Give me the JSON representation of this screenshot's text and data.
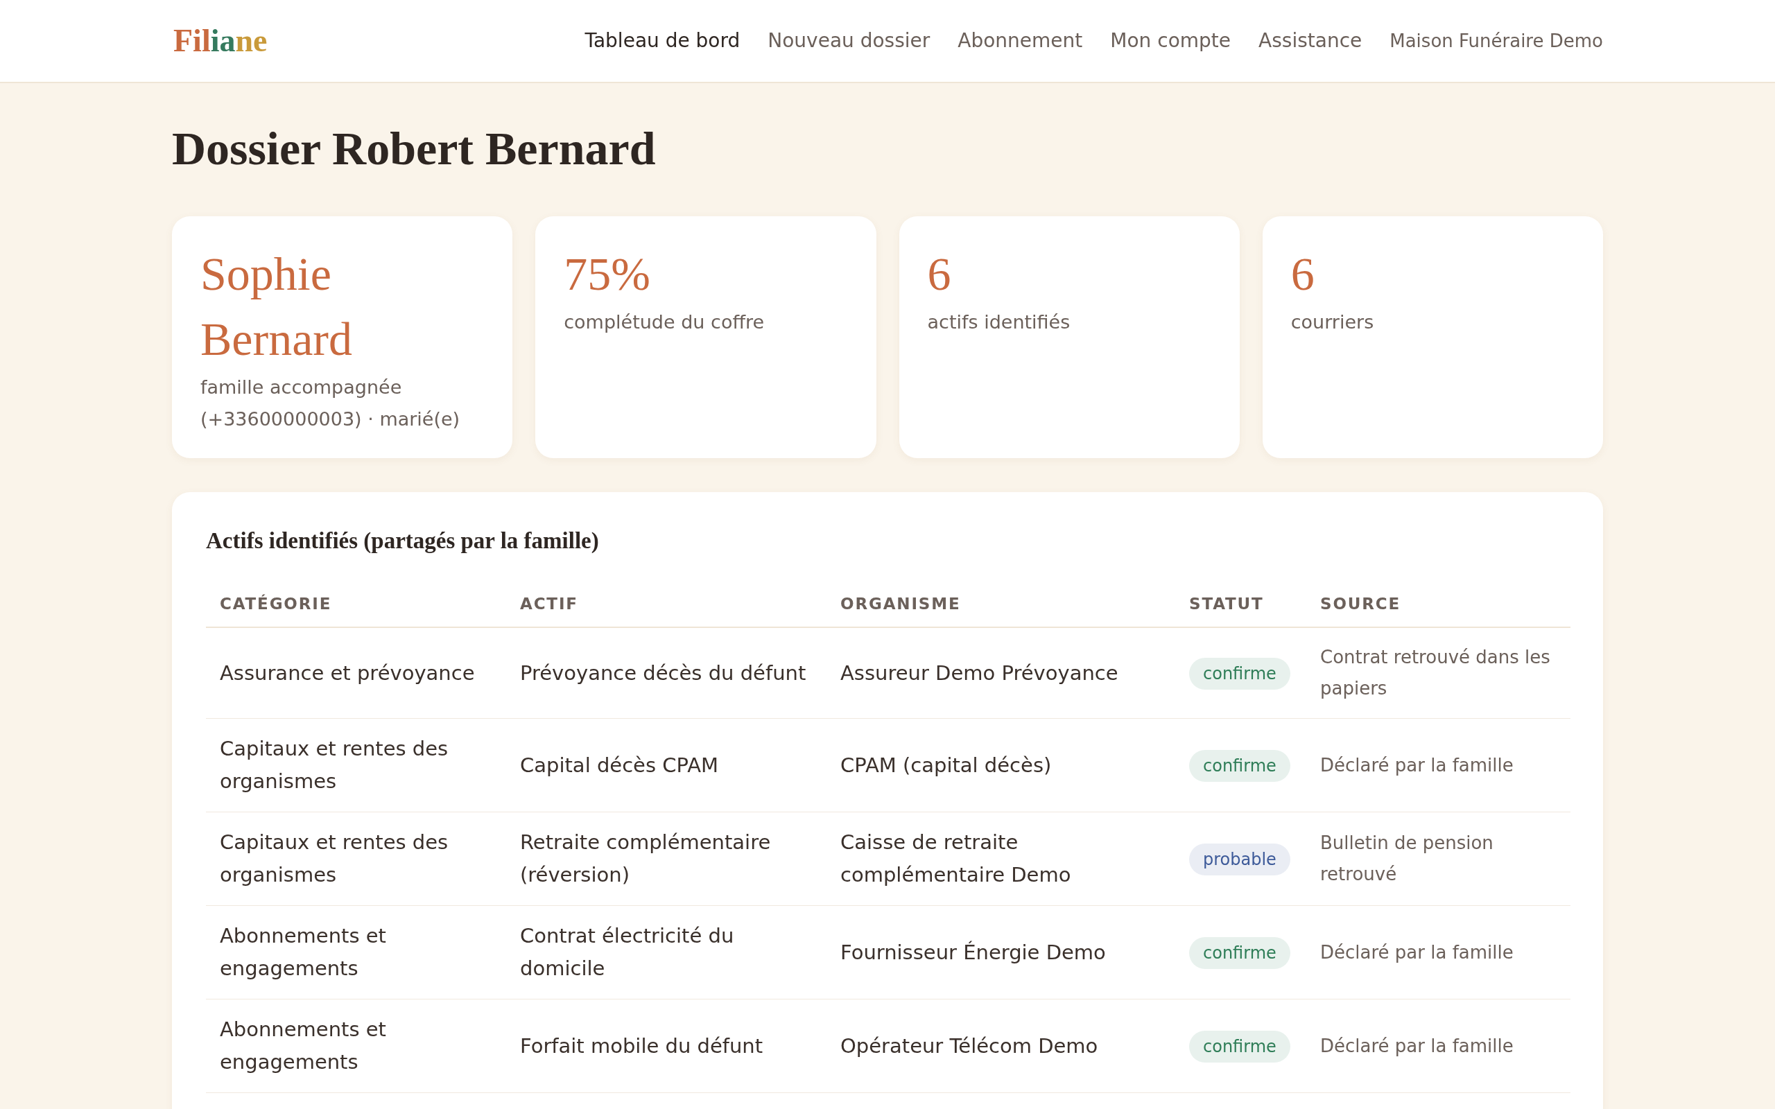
{
  "header": {
    "logo": [
      {
        "text": "Fil",
        "color": "#c96a3f"
      },
      {
        "text": "ia",
        "color": "#357a5e"
      },
      {
        "text": "ne",
        "color": "#c99a3a"
      }
    ],
    "nav": [
      {
        "label": "Tableau de bord",
        "selected": true
      },
      {
        "label": "Nouveau dossier",
        "selected": false
      },
      {
        "label": "Abonnement",
        "selected": false
      },
      {
        "label": "Mon compte",
        "selected": false
      },
      {
        "label": "Assistance",
        "selected": false
      }
    ],
    "account": "Maison Funéraire Demo"
  },
  "page_title": "Dossier Robert Bernard",
  "stats": [
    {
      "value": "Sophie Bernard",
      "label": "famille accompagnée (+33600000003) · marié(e)"
    },
    {
      "value": "75%",
      "label": "complétude du coffre"
    },
    {
      "value": "6",
      "label": "actifs identifiés"
    },
    {
      "value": "6",
      "label": "courriers"
    }
  ],
  "assets": {
    "title": "Actifs identifiés (partagés par la famille)",
    "columns": [
      "CATÉGORIE",
      "ACTIF",
      "ORGANISME",
      "STATUT",
      "SOURCE"
    ],
    "rows": [
      {
        "category": "Assurance et prévoyance",
        "asset": "Prévoyance décès du défunt",
        "organization": "Assureur Demo Prévoyance",
        "status": {
          "label": "confirme",
          "color": "#2e7d57"
        },
        "source": "Contrat retrouvé dans les papiers"
      },
      {
        "category": "Capitaux et rentes des organismes",
        "asset": "Capital décès CPAM",
        "organization": "CPAM (capital décès)",
        "status": {
          "label": "confirme",
          "color": "#2e7d57"
        },
        "source": "Déclaré par la famille"
      },
      {
        "category": "Capitaux et rentes des organismes",
        "asset": "Retraite complémentaire (réversion)",
        "organization": "Caisse de retraite complémentaire Demo",
        "status": {
          "label": "probable",
          "color": "#3d5a99"
        },
        "source": "Bulletin de pension retrouvé"
      },
      {
        "category": "Abonnements et engagements",
        "asset": "Contrat électricité du domicile",
        "organization": "Fournisseur Énergie Demo",
        "status": {
          "label": "confirme",
          "color": "#2e7d57"
        },
        "source": "Déclaré par la famille"
      },
      {
        "category": "Abonnements et engagements",
        "asset": "Forfait mobile du défunt",
        "organization": "Opérateur Télécom Demo",
        "status": {
          "label": "confirme",
          "color": "#2e7d57"
        },
        "source": "Déclaré par la famille"
      }
    ]
  }
}
